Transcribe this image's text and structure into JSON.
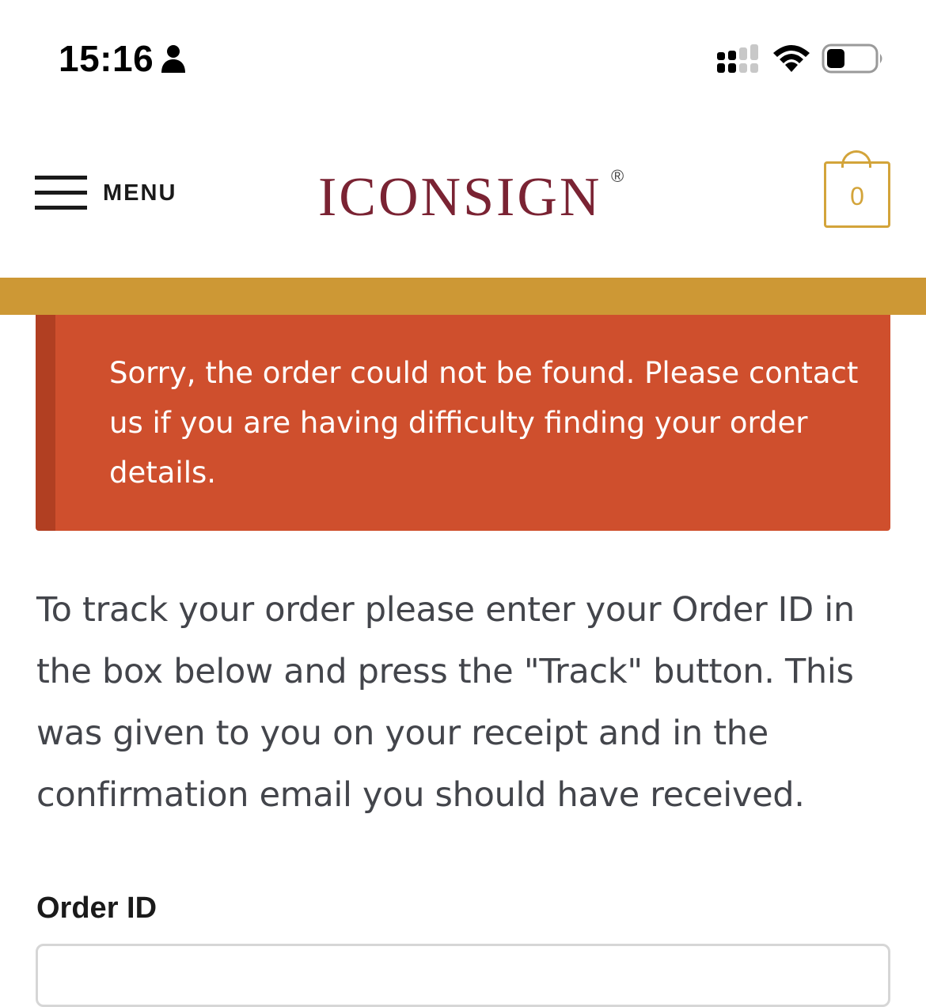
{
  "status_bar": {
    "time": "15:16",
    "icons": [
      "person-icon",
      "cellular-signal-icon",
      "wifi-icon",
      "battery-icon"
    ]
  },
  "header": {
    "menu_label": "MENU",
    "logo_text": "ICONSIGN",
    "logo_registered": "®",
    "cart_count": "0"
  },
  "error_notice": {
    "message": "Sorry, the order could not be found. Please contact us if you are having difficulty finding your order details."
  },
  "intro": {
    "text": "To track your order please enter your Order ID in the box below and press the \"Track\" button. This was given to you on your receipt and in the confirmation email you should have received."
  },
  "form": {
    "order_id_label": "Order ID",
    "order_id_value": ""
  },
  "colors": {
    "brand": "#7a2333",
    "accent_gold": "#cd9835",
    "error_bg": "#cf4f2d",
    "error_border": "#b13f22",
    "body_text": "#43454b"
  }
}
